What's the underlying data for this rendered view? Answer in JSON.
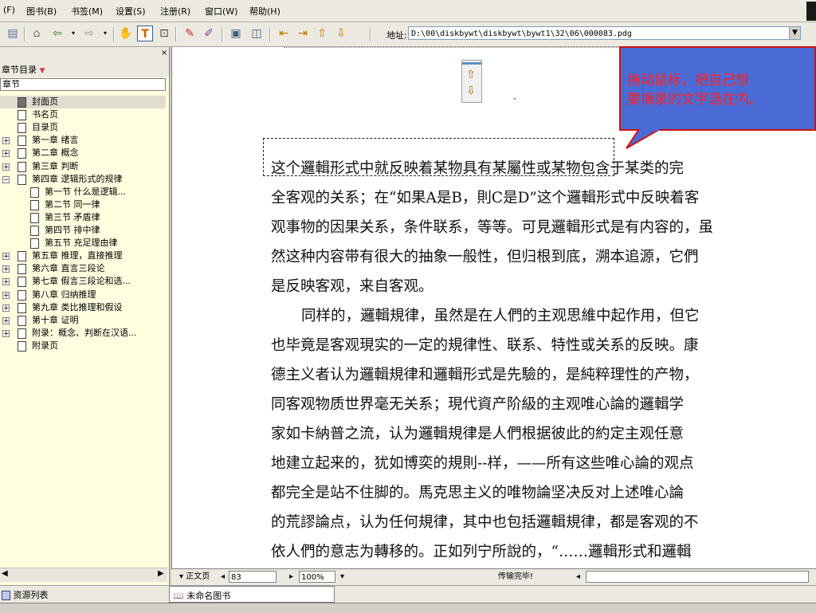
{
  "menu": [
    "(F)",
    "图书(B)",
    "书签(M)",
    "设置(S)",
    "注册(R)",
    "窗口(W)",
    "帮助(H)"
  ],
  "toolbar": {
    "address_label": "地址:",
    "address_value": "D:\\00\\diskbywt\\diskbywt\\bywt1\\32\\06\\000083.pdg"
  },
  "sidebar": {
    "title": "章节目录",
    "close": "×",
    "column_header": "章节",
    "items": [
      {
        "label": "封面页",
        "level": 1,
        "expander": "",
        "selected": true
      },
      {
        "label": "书名页",
        "level": 1,
        "expander": ""
      },
      {
        "label": "目录页",
        "level": 1,
        "expander": ""
      },
      {
        "label": "第一章 绪言",
        "level": 1,
        "expander": "+"
      },
      {
        "label": "第二章 概念",
        "level": 1,
        "expander": "+"
      },
      {
        "label": "第三章 判断",
        "level": 1,
        "expander": "+"
      },
      {
        "label": "第四章 逻辑形式的规律",
        "level": 1,
        "expander": "−"
      },
      {
        "label": "第一节 什么是逻辑...",
        "level": 2,
        "expander": ""
      },
      {
        "label": "第二节 同一律",
        "level": 2,
        "expander": ""
      },
      {
        "label": "第三节 矛盾律",
        "level": 2,
        "expander": ""
      },
      {
        "label": "第四节 排中律",
        "level": 2,
        "expander": ""
      },
      {
        "label": "第五节 充足理由律",
        "level": 2,
        "expander": ""
      },
      {
        "label": "第五章 推理，直接推理",
        "level": 1,
        "expander": "+"
      },
      {
        "label": "第六章 直言三段论",
        "level": 1,
        "expander": "+"
      },
      {
        "label": "第七章 假言三段论和选...",
        "level": 1,
        "expander": "+"
      },
      {
        "label": "第八章 归纳推理",
        "level": 1,
        "expander": "+"
      },
      {
        "label": "第九章 类比推理和假设",
        "level": 1,
        "expander": "+"
      },
      {
        "label": "第十章 证明",
        "level": 1,
        "expander": "+"
      },
      {
        "label": "附录：概念、判断在汉语...",
        "level": 1,
        "expander": "+"
      },
      {
        "label": "附录页",
        "level": 1,
        "expander": ""
      }
    ]
  },
  "callout": {
    "line1": "拖动鼠标，把自己想",
    "line2": "要摘录的文字选在内。"
  },
  "content_lines": [
    "这个邏輯形式中就反映着某物具有某屬性或某物包含于某类的完",
    "全客观的关系；在“如果A是B，則C是D”这个邏輯形式中反映着客",
    "观事物的因果关系，条件联系，等等。可見邏輯形式是有内容的，虽",
    "然这种内容带有很大的抽象一般性，但归根到底，溯本追源，它們",
    "是反映客观，来自客观。",
    "同样的，邏輯規律，虽然是在人們的主观思維中起作用，但它",
    "也毕竟是客观現实的一定的規律性、联系、特性或关系的反映。康",
    "德主义者认为邏輯規律和邏輯形式是先驗的，是純粹理性的产物，",
    "同客观物质世界毫无关系；現代資产阶級的主观唯心論的邏輯学",
    "家如卡納普之流，认为邏輯規律是人們根据彼此的約定主观任意",
    "地建立起来的，犹如博奕的規則--样，——所有这些唯心論的观点",
    "都完全是站不住脚的。馬克思主义的唯物論坚决反对上述唯心論",
    "的荒謬論点，认为任何規律，其中也包括邏輯規律，都是客观的不",
    "依人們的意志为轉移的。正如列宁所說的，“……邏輯形式和邏輯"
  ],
  "pagebar": {
    "view_mode": "▾ 正文页",
    "page_number": "83",
    "zoom": "100%",
    "status": "传输完毕!"
  },
  "taskbar": {
    "resource_list": "资源列表",
    "book_title": "未命名图书"
  }
}
